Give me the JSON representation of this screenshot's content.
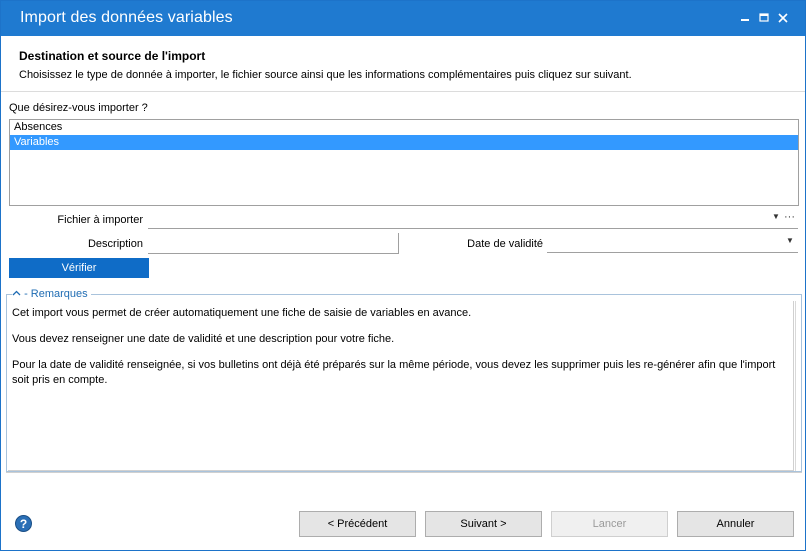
{
  "window": {
    "title": "Import des données variables",
    "controls": [
      "minimize-icon",
      "maximize-icon",
      "close-icon"
    ]
  },
  "header": {
    "title": "Destination et source de l'import",
    "subtitle": "Choisissez le type de donnée à importer, le fichier source ainsi que les informations complémentaires puis cliquez sur suivant."
  },
  "import_type": {
    "question": "Que désirez-vous importer ?",
    "items": [
      {
        "label": "Absences",
        "selected": false
      },
      {
        "label": "Variables",
        "selected": true
      }
    ]
  },
  "form": {
    "file_label": "Fichier à importer",
    "file_value": "",
    "ellipsis": "···",
    "description_label": "Description",
    "description_value": "",
    "date_label": "Date de validité",
    "date_value": "",
    "verify_label": "Vérifier"
  },
  "remarks": {
    "legend": "- Remarques",
    "paragraphs": [
      "Cet import vous permet de créer automatiquement une fiche de saisie de variables en avance.",
      "Vous devez renseigner une date de validité et une description pour votre fiche.",
      "Pour la date de validité renseignée, si vos bulletins ont déjà été préparés sur la même période, vous devez les supprimer puis les re-générer afin que l'import soit pris en compte."
    ]
  },
  "footer": {
    "help_glyph": "?",
    "previous_label": "< Précédent",
    "next_label": "Suivant >",
    "launch_label": "Lancer",
    "cancel_label": "Annuler"
  },
  "colors": {
    "titlebar": "#1f7ad0",
    "selection": "#3399ff",
    "verify_button": "#0f6cc7",
    "legend_text": "#1f6cb3"
  }
}
